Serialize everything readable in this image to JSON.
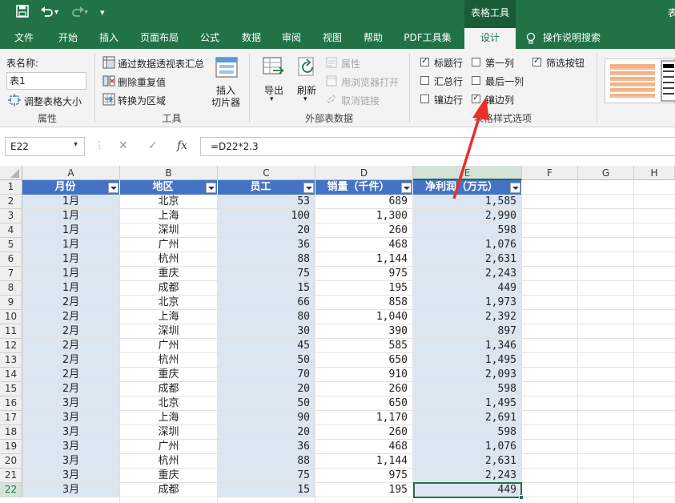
{
  "qat": {
    "save_icon": "save-icon",
    "undo_icon": "undo-icon",
    "redo_icon": "redo-icon",
    "more": "▾"
  },
  "context_group": "表格工具",
  "title_right": "表",
  "tabs": [
    "文件",
    "开始",
    "插入",
    "页面布局",
    "公式",
    "数据",
    "审阅",
    "视图",
    "帮助",
    "PDF工具集",
    "设计"
  ],
  "active_tab": "设计",
  "tell_me": "操作说明搜索",
  "ribbon": {
    "properties": {
      "table_name_label": "表名称:",
      "table_name_value": "表1",
      "resize": "调整表格大小",
      "group": "属性"
    },
    "tools": {
      "pivot": "通过数据透视表汇总",
      "dedupe": "删除重复值",
      "to_range": "转换为区域",
      "slicer": "插入\n切片器",
      "slicer_l1": "插入",
      "slicer_l2": "切片器",
      "group": "工具"
    },
    "external": {
      "export": "导出",
      "refresh": "刷新",
      "props": "属性",
      "open_browser": "用浏览器打开",
      "unlink": "取消链接",
      "group": "外部表数据"
    },
    "style_options": {
      "header_row": "标题行",
      "total_row": "汇总行",
      "banded_rows": "镶边行",
      "first_col": "第一列",
      "last_col": "最后一列",
      "banded_cols": "镶边列",
      "filter_btn": "筛选按钮",
      "group": "表格样式选项"
    },
    "checks": {
      "header_row": true,
      "total_row": false,
      "banded_rows": false,
      "first_col": false,
      "last_col": false,
      "banded_cols": true,
      "filter_btn": true
    }
  },
  "formula_bar": {
    "name_box": "E22",
    "formula": "=D22*2.3",
    "cancel": "✕",
    "enter": "✓",
    "fx": "fx"
  },
  "columns": [
    "A",
    "B",
    "C",
    "D",
    "E",
    "F",
    "G",
    "H"
  ],
  "selected_column": "E",
  "selected_row": 22,
  "table": {
    "headers": [
      "月份",
      "地区",
      "员工",
      "销量（千件）",
      "净利润（万元）"
    ],
    "rows": [
      [
        "1月",
        "北京",
        "53",
        "689",
        "1,585"
      ],
      [
        "1月",
        "上海",
        "100",
        "1,300",
        "2,990"
      ],
      [
        "1月",
        "深圳",
        "20",
        "260",
        "598"
      ],
      [
        "1月",
        "广州",
        "36",
        "468",
        "1,076"
      ],
      [
        "1月",
        "杭州",
        "88",
        "1,144",
        "2,631"
      ],
      [
        "1月",
        "重庆",
        "75",
        "975",
        "2,243"
      ],
      [
        "1月",
        "成都",
        "15",
        "195",
        "449"
      ],
      [
        "2月",
        "北京",
        "66",
        "858",
        "1,973"
      ],
      [
        "2月",
        "上海",
        "80",
        "1,040",
        "2,392"
      ],
      [
        "2月",
        "深圳",
        "30",
        "390",
        "897"
      ],
      [
        "2月",
        "广州",
        "45",
        "585",
        "1,346"
      ],
      [
        "2月",
        "杭州",
        "50",
        "650",
        "1,495"
      ],
      [
        "2月",
        "重庆",
        "70",
        "910",
        "2,093"
      ],
      [
        "2月",
        "成都",
        "20",
        "260",
        "598"
      ],
      [
        "3月",
        "北京",
        "50",
        "650",
        "1,495"
      ],
      [
        "3月",
        "上海",
        "90",
        "1,170",
        "2,691"
      ],
      [
        "3月",
        "深圳",
        "20",
        "260",
        "598"
      ],
      [
        "3月",
        "广州",
        "36",
        "468",
        "1,076"
      ],
      [
        "3月",
        "杭州",
        "88",
        "1,144",
        "2,631"
      ],
      [
        "3月",
        "重庆",
        "75",
        "975",
        "2,243"
      ],
      [
        "3月",
        "成都",
        "15",
        "195",
        "449"
      ]
    ]
  },
  "colors": {
    "excel_green": "#217346",
    "table_header": "#4472c4",
    "band": "#dce6f1",
    "arrow": "#e8302a"
  }
}
